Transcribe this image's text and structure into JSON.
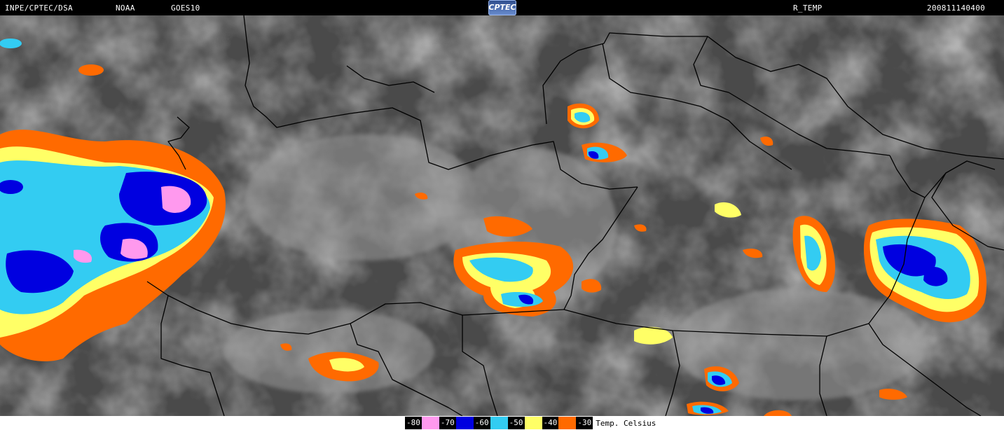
{
  "header": {
    "institution": "INPE/CPTEC/DSA",
    "agency": "NOAA",
    "satellite": "GOES10",
    "logo": "CPTEC",
    "product": "R_TEMP",
    "datetime": "200811140400"
  },
  "legend": {
    "unit": "Temp. Celsius",
    "items": [
      {
        "label": "-80",
        "color": "#ff99ee"
      },
      {
        "label": "-70",
        "color": "#0000e0"
      },
      {
        "label": "-60",
        "color": "#33ccf2"
      },
      {
        "label": "-50",
        "color": "#ffff66"
      },
      {
        "label": "-40",
        "color": "#ff6a00"
      },
      {
        "label": "-30",
        "color": ""
      }
    ]
  }
}
